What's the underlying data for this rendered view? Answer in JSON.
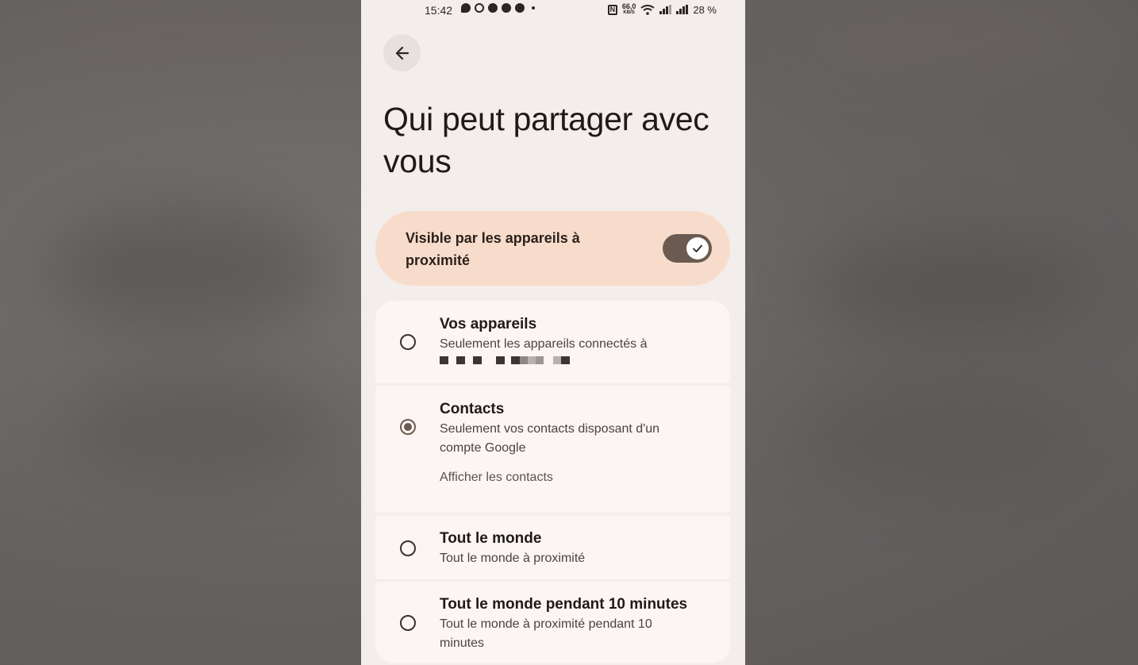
{
  "status_bar": {
    "time": "15:42",
    "nfc": "N",
    "net_speed": "66,0",
    "net_unit": "KB/S",
    "battery": "28 %"
  },
  "header": {
    "back_icon": "arrow-left-icon",
    "title": "Qui peut partager avec vous"
  },
  "visibility": {
    "label": "Visible par les appareils à proximité",
    "enabled": true
  },
  "options": [
    {
      "title": "Vos appareils",
      "description": "Seulement les appareils connectés à",
      "selected": false
    },
    {
      "title": "Contacts",
      "description": "Seulement vos contacts disposant d'un compte Google",
      "link": "Afficher les contacts",
      "selected": true
    },
    {
      "title": "Tout le monde",
      "description": "Tout le monde à proximité",
      "selected": false
    },
    {
      "title": "Tout le monde pendant 10 minutes",
      "description": "Tout le monde à proximité pendant 10 minutes",
      "selected": false
    }
  ],
  "colors": {
    "accent": "#6b5a51",
    "toggle_card": "#f8dccb",
    "screen_bg": "#f3edeb",
    "option_bg": "#fcf5f3"
  }
}
